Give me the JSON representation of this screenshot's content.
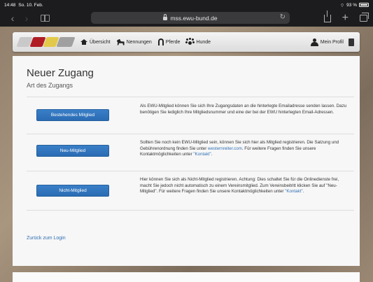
{
  "statusbar": {
    "time": "14:48",
    "date": "So. 10. Feb.",
    "battery": "93 %"
  },
  "browser": {
    "url": "mss.ewu-bund.de"
  },
  "nav": {
    "items": [
      {
        "label": "Übersicht"
      },
      {
        "label": "Nennungen"
      },
      {
        "label": "Pferde"
      },
      {
        "label": "Hunde"
      }
    ],
    "profile": "Mein Profil"
  },
  "page": {
    "title": "Neuer Zugang",
    "subtitle": "Art des Zugangs",
    "options": [
      {
        "button": "Bestehendes Mitglied",
        "text": "Als EWU-Mitglied können Sie sich Ihre Zugangsdaten an die hinterlegte Emailadresse senden lassen. Dazu benötigen Sie lediglich Ihre Mitgliedsnummer und eine der bei der EWU hinterlegten Email-Adressen."
      },
      {
        "button": "Neu-Mitglied",
        "text_a": "Sollten Sie noch kein EWU-Mitglied sein, können Sie sich hier als Mitglied registrieren. Die Satzung und Gebührenordnung finden Sie unter ",
        "link1": "westernreiter.com",
        "text_b": ". Für weitere Fragen finden Sie unsere Kontaktmöglichkeiten unter ",
        "link2": "\"Kontakt\"",
        "text_c": "."
      },
      {
        "button": "Nicht-Mitglied",
        "text_a": "Hier können Sie sich als Nicht-Mitglied registrieren. Achtung: Dies schaltet Sie für die Onlinedienste frei, macht Sie jedoch nicht automatisch zu einem Vereinsmitglied. Zum Vereinsbeitritt klicken Sie auf \"Neu-Mitglied\". Für weitere Fragen finden Sie unsere Kontaktmöglichkeiten unter ",
        "link": "\"Kontakt\"",
        "text_b": "."
      }
    ],
    "back_link": "Zurück zum Login"
  },
  "colors": {
    "button": "#2f74bd",
    "link": "#2f6fb4"
  }
}
